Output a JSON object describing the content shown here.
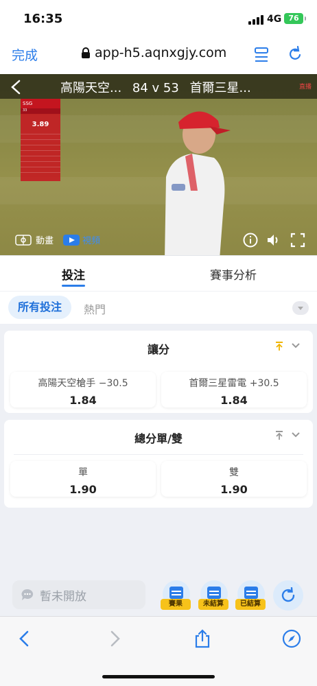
{
  "status_bar": {
    "time": "16:35",
    "network": "4G",
    "battery": "76"
  },
  "browser": {
    "done_label": "完成",
    "url": "app-h5.aqnxgjy.com"
  },
  "video": {
    "home_team_short": "高陽天空...",
    "score": "84 v 53",
    "away_team_short": "首爾三星...",
    "live_label": "直播",
    "animation_label": "動畫",
    "video_label": "視頻",
    "overlay": {
      "team": "SSG",
      "number": "33",
      "stat_big": "3.89"
    }
  },
  "tabs": {
    "active": "投注",
    "inactive": "賽事分析"
  },
  "filters": {
    "all": "所有投注",
    "hot": "熱門"
  },
  "markets": [
    {
      "title": "讓分",
      "options": [
        {
          "name": "高陽天空槍手 −30.5",
          "odds": "1.84"
        },
        {
          "name": "首爾三星雷電 +30.5",
          "odds": "1.84"
        }
      ]
    },
    {
      "title": "總分單/雙",
      "options": [
        {
          "name": "單",
          "odds": "1.90"
        },
        {
          "name": "雙",
          "odds": "1.90"
        }
      ]
    }
  ],
  "dock": {
    "chat_placeholder": "暫未開放",
    "tools": [
      "賽果",
      "未結算",
      "已結算"
    ]
  },
  "colors": {
    "accent": "#2b7de9",
    "badge": "#f7c21a",
    "battery": "#34c759"
  }
}
